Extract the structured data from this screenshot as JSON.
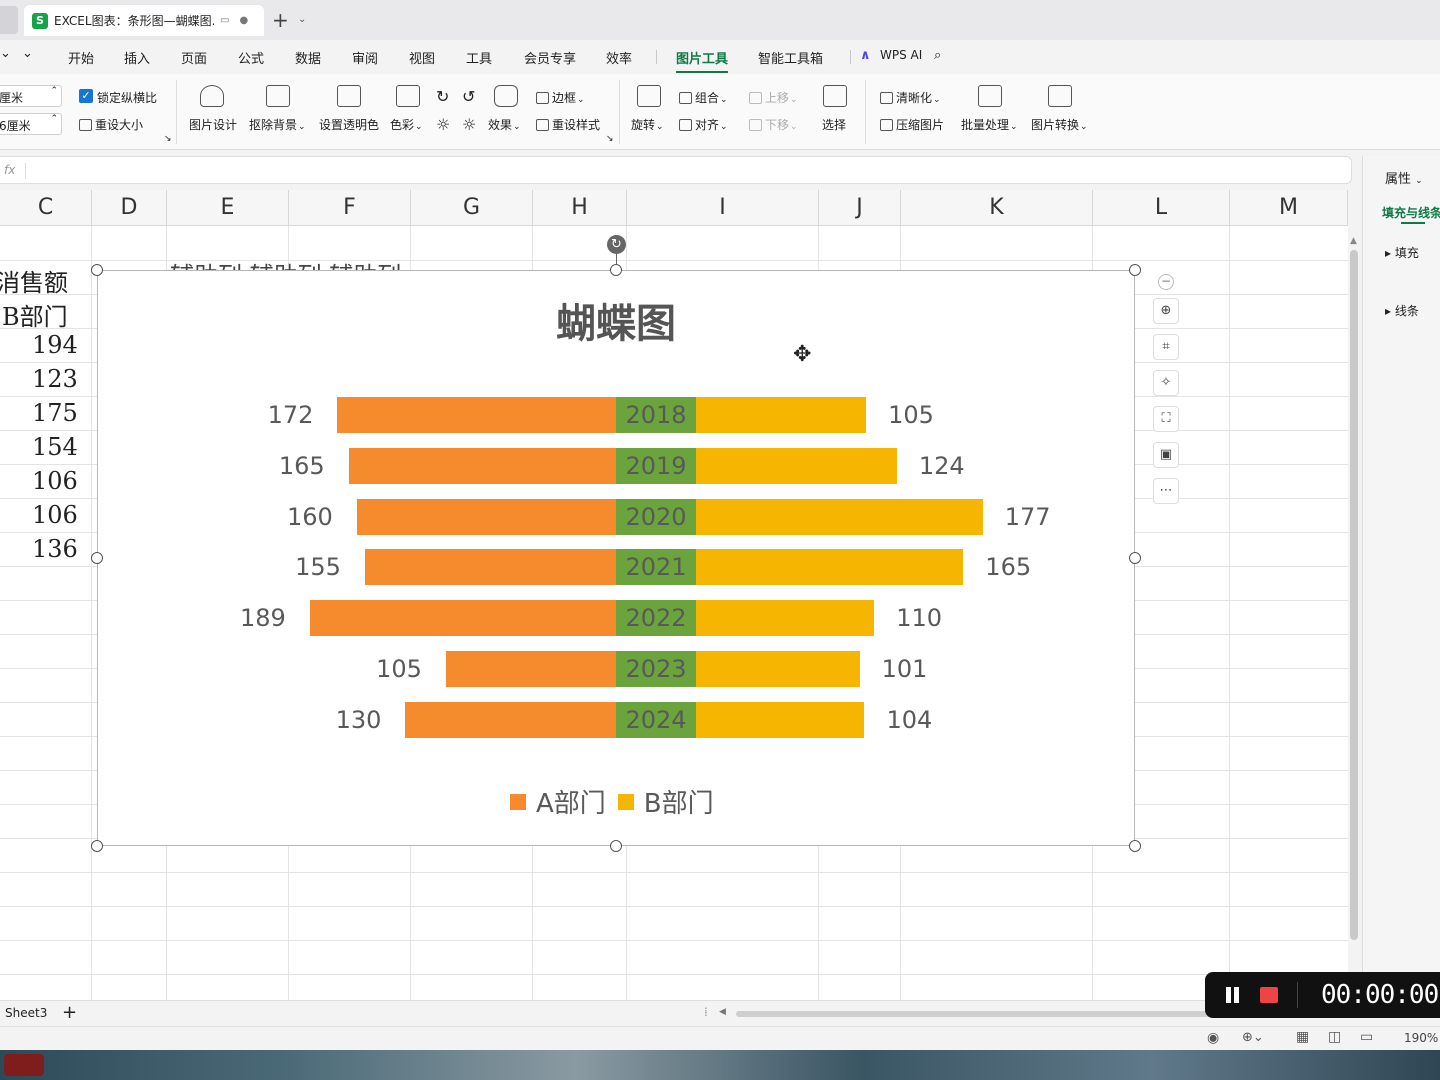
{
  "titlebar": {
    "tab_title": "EXCEL图表：条形图—蝴蝶图.",
    "logo_letter": "S"
  },
  "menu": {
    "items": [
      "开始",
      "插入",
      "页面",
      "公式",
      "数据",
      "审阅",
      "视图",
      "工具",
      "会员专享",
      "效率",
      "图片工具",
      "智能工具箱",
      "WPS AI"
    ],
    "active": "图片工具"
  },
  "ribbon": {
    "height_value": "厘米",
    "width_value": "6厘米",
    "lock_ratio": "锁定纵横比",
    "reset_size": "重设大小",
    "picture_design": "图片设计",
    "remove_bg": "抠除背景",
    "set_transparent": "设置透明色",
    "color": "色彩",
    "effects": "效果",
    "border": "边框",
    "reset_style": "重设样式",
    "rotate": "旋转",
    "group": "组合",
    "align": "对齐",
    "move_up": "上移",
    "move_down": "下移",
    "select": "选择",
    "sharpen": "清晰化",
    "compress": "压缩图片",
    "batch": "批量处理",
    "convert": "图片转换"
  },
  "formula_bar": {
    "fx": "fx"
  },
  "columns": [
    "C",
    "D",
    "E",
    "F",
    "G",
    "H",
    "I",
    "J",
    "K",
    "L",
    "M"
  ],
  "cells": {
    "c_header1": "消售额",
    "c_header2": "B部门",
    "c_values": [
      "194",
      "123",
      "175",
      "154",
      "106",
      "106",
      "136"
    ],
    "hidden_text": "辅助列  辅助列  辅助列"
  },
  "chart_data": {
    "type": "bar",
    "title": "蝴蝶图",
    "categories": [
      "2018",
      "2019",
      "2020",
      "2021",
      "2022",
      "2023",
      "2024"
    ],
    "series": [
      {
        "name": "A部门",
        "values": [
          172,
          165,
          160,
          155,
          189,
          105,
          130
        ],
        "color": "#f58b2c"
      },
      {
        "name": "B部门",
        "values": [
          105,
          124,
          177,
          165,
          110,
          101,
          104
        ],
        "color": "#f6b500"
      }
    ],
    "center_band_color": "#6ba33c",
    "legend_position": "bottom"
  },
  "right_panel": {
    "title": "属性",
    "tab": "填充与线条",
    "fill": "填充",
    "line": "线条"
  },
  "sheet": {
    "tab": "Sheet3",
    "add": "+"
  },
  "status": {
    "zoom": "190%"
  },
  "recorder": {
    "time": "00:00:00"
  }
}
